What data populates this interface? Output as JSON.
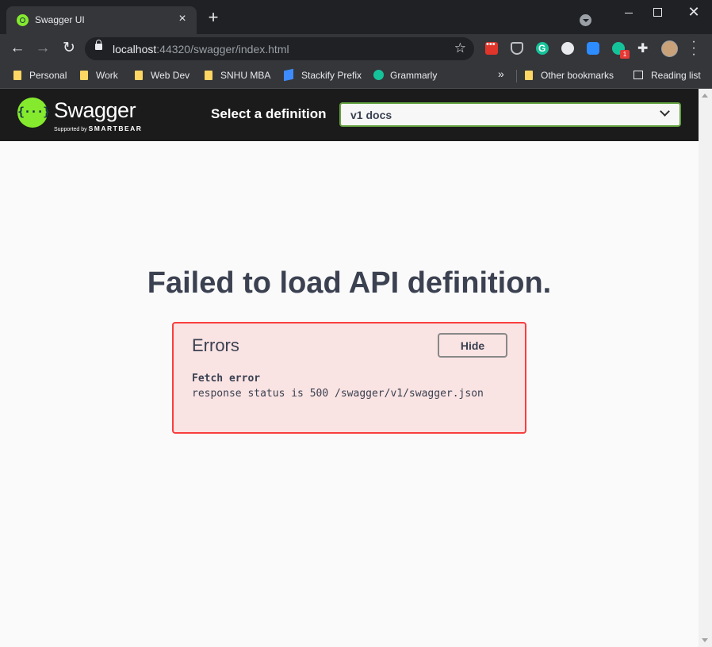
{
  "browser": {
    "tab_title": "Swagger UI",
    "url_host": "localhost",
    "url_rest": ":44320/swagger/index.html",
    "extension_badge": "1",
    "bookmarks": [
      {
        "label": "Personal",
        "icon": "folder-icon"
      },
      {
        "label": "Work",
        "icon": "folder-icon"
      },
      {
        "label": "Web Dev",
        "icon": "folder-icon"
      },
      {
        "label": "SNHU MBA",
        "icon": "folder-icon"
      },
      {
        "label": "Stackify Prefix",
        "icon": "stackify-icon"
      },
      {
        "label": "Grammarly",
        "icon": "grammarly-icon"
      }
    ],
    "overflow_label": "»",
    "other_bookmarks": "Other bookmarks",
    "reading_list": "Reading list"
  },
  "swagger": {
    "brand": "Swagger",
    "supported_by": "Supported by",
    "smartbear": "SMARTBEAR",
    "select_label": "Select a definition",
    "selected_definition": "v1 docs"
  },
  "page": {
    "title": "Failed to load API definition."
  },
  "errors": {
    "heading": "Errors",
    "hide_label": "Hide",
    "error_name": "Fetch error",
    "error_message": "response status is 500 /swagger/v1/swagger.json"
  },
  "colors": {
    "swagger_green": "#85ea2d",
    "topbar": "#1b1b1b",
    "error_red": "#f93e3e",
    "text": "#3b4151"
  }
}
